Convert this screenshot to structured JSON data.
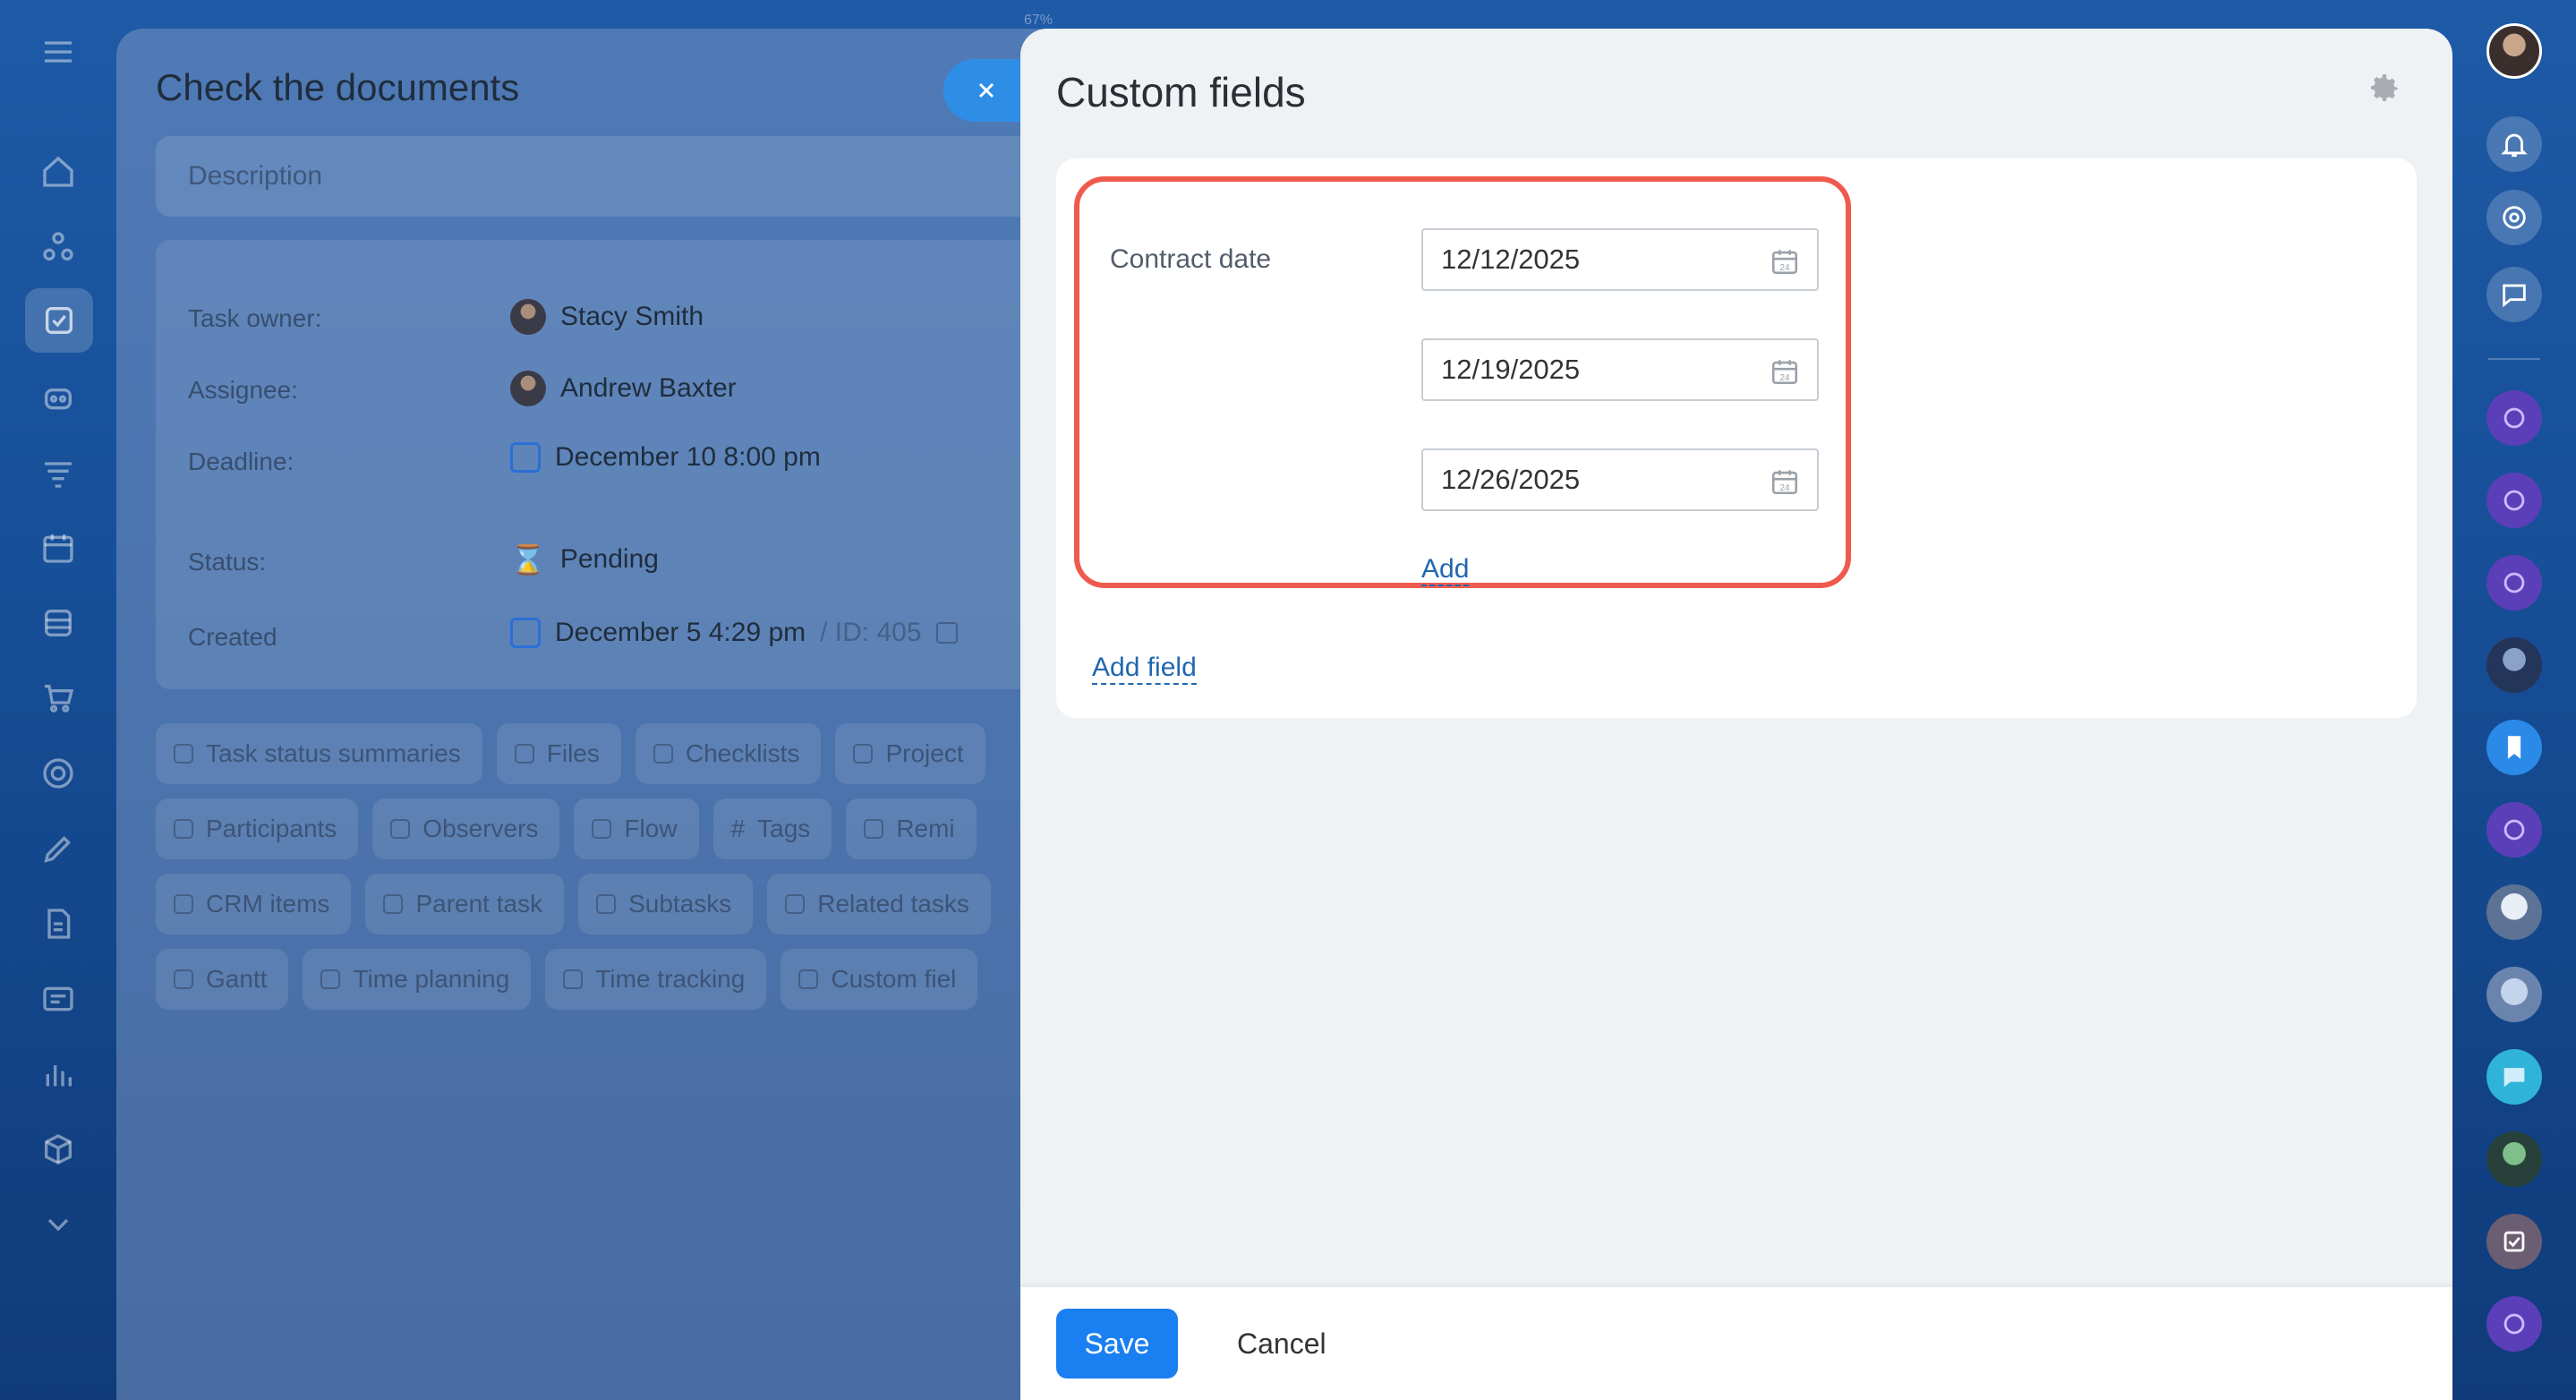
{
  "zoom_label": "67%",
  "task": {
    "title": "Check the documents",
    "description_placeholder": "Description",
    "rows": {
      "owner_label": "Task owner:",
      "owner_value": "Stacy Smith",
      "assignee_label": "Assignee:",
      "assignee_value": "Andrew Baxter",
      "deadline_label": "Deadline:",
      "deadline_value": "December 10 8:00 pm",
      "status_label": "Status:",
      "status_value": "Pending",
      "created_label": "Created",
      "created_value": "December 5 4:29 pm",
      "id_value": "/ ID: 405"
    },
    "chips_row1": [
      "Task status summaries",
      "Files",
      "Checklists",
      "Project"
    ],
    "chips_row2": [
      "Participants",
      "Observers",
      "Flow",
      "Tags",
      "Remi"
    ],
    "chips_row3": [
      "CRM items",
      "Parent task",
      "Subtasks",
      "Related tasks"
    ],
    "chips_row4": [
      "Gantt",
      "Time planning",
      "Time tracking",
      "Custom fiel"
    ]
  },
  "slider": {
    "title": "Custom fields",
    "field_label": "Contract date",
    "dates": [
      "12/12/2025",
      "12/19/2025",
      "12/26/2025"
    ],
    "add_label": "Add",
    "add_field_label": "Add field",
    "save_label": "Save",
    "cancel_label": "Cancel"
  },
  "colors": {
    "accent": "#1a7ff0",
    "highlight": "#ef5a4e",
    "link": "#2067b0"
  }
}
